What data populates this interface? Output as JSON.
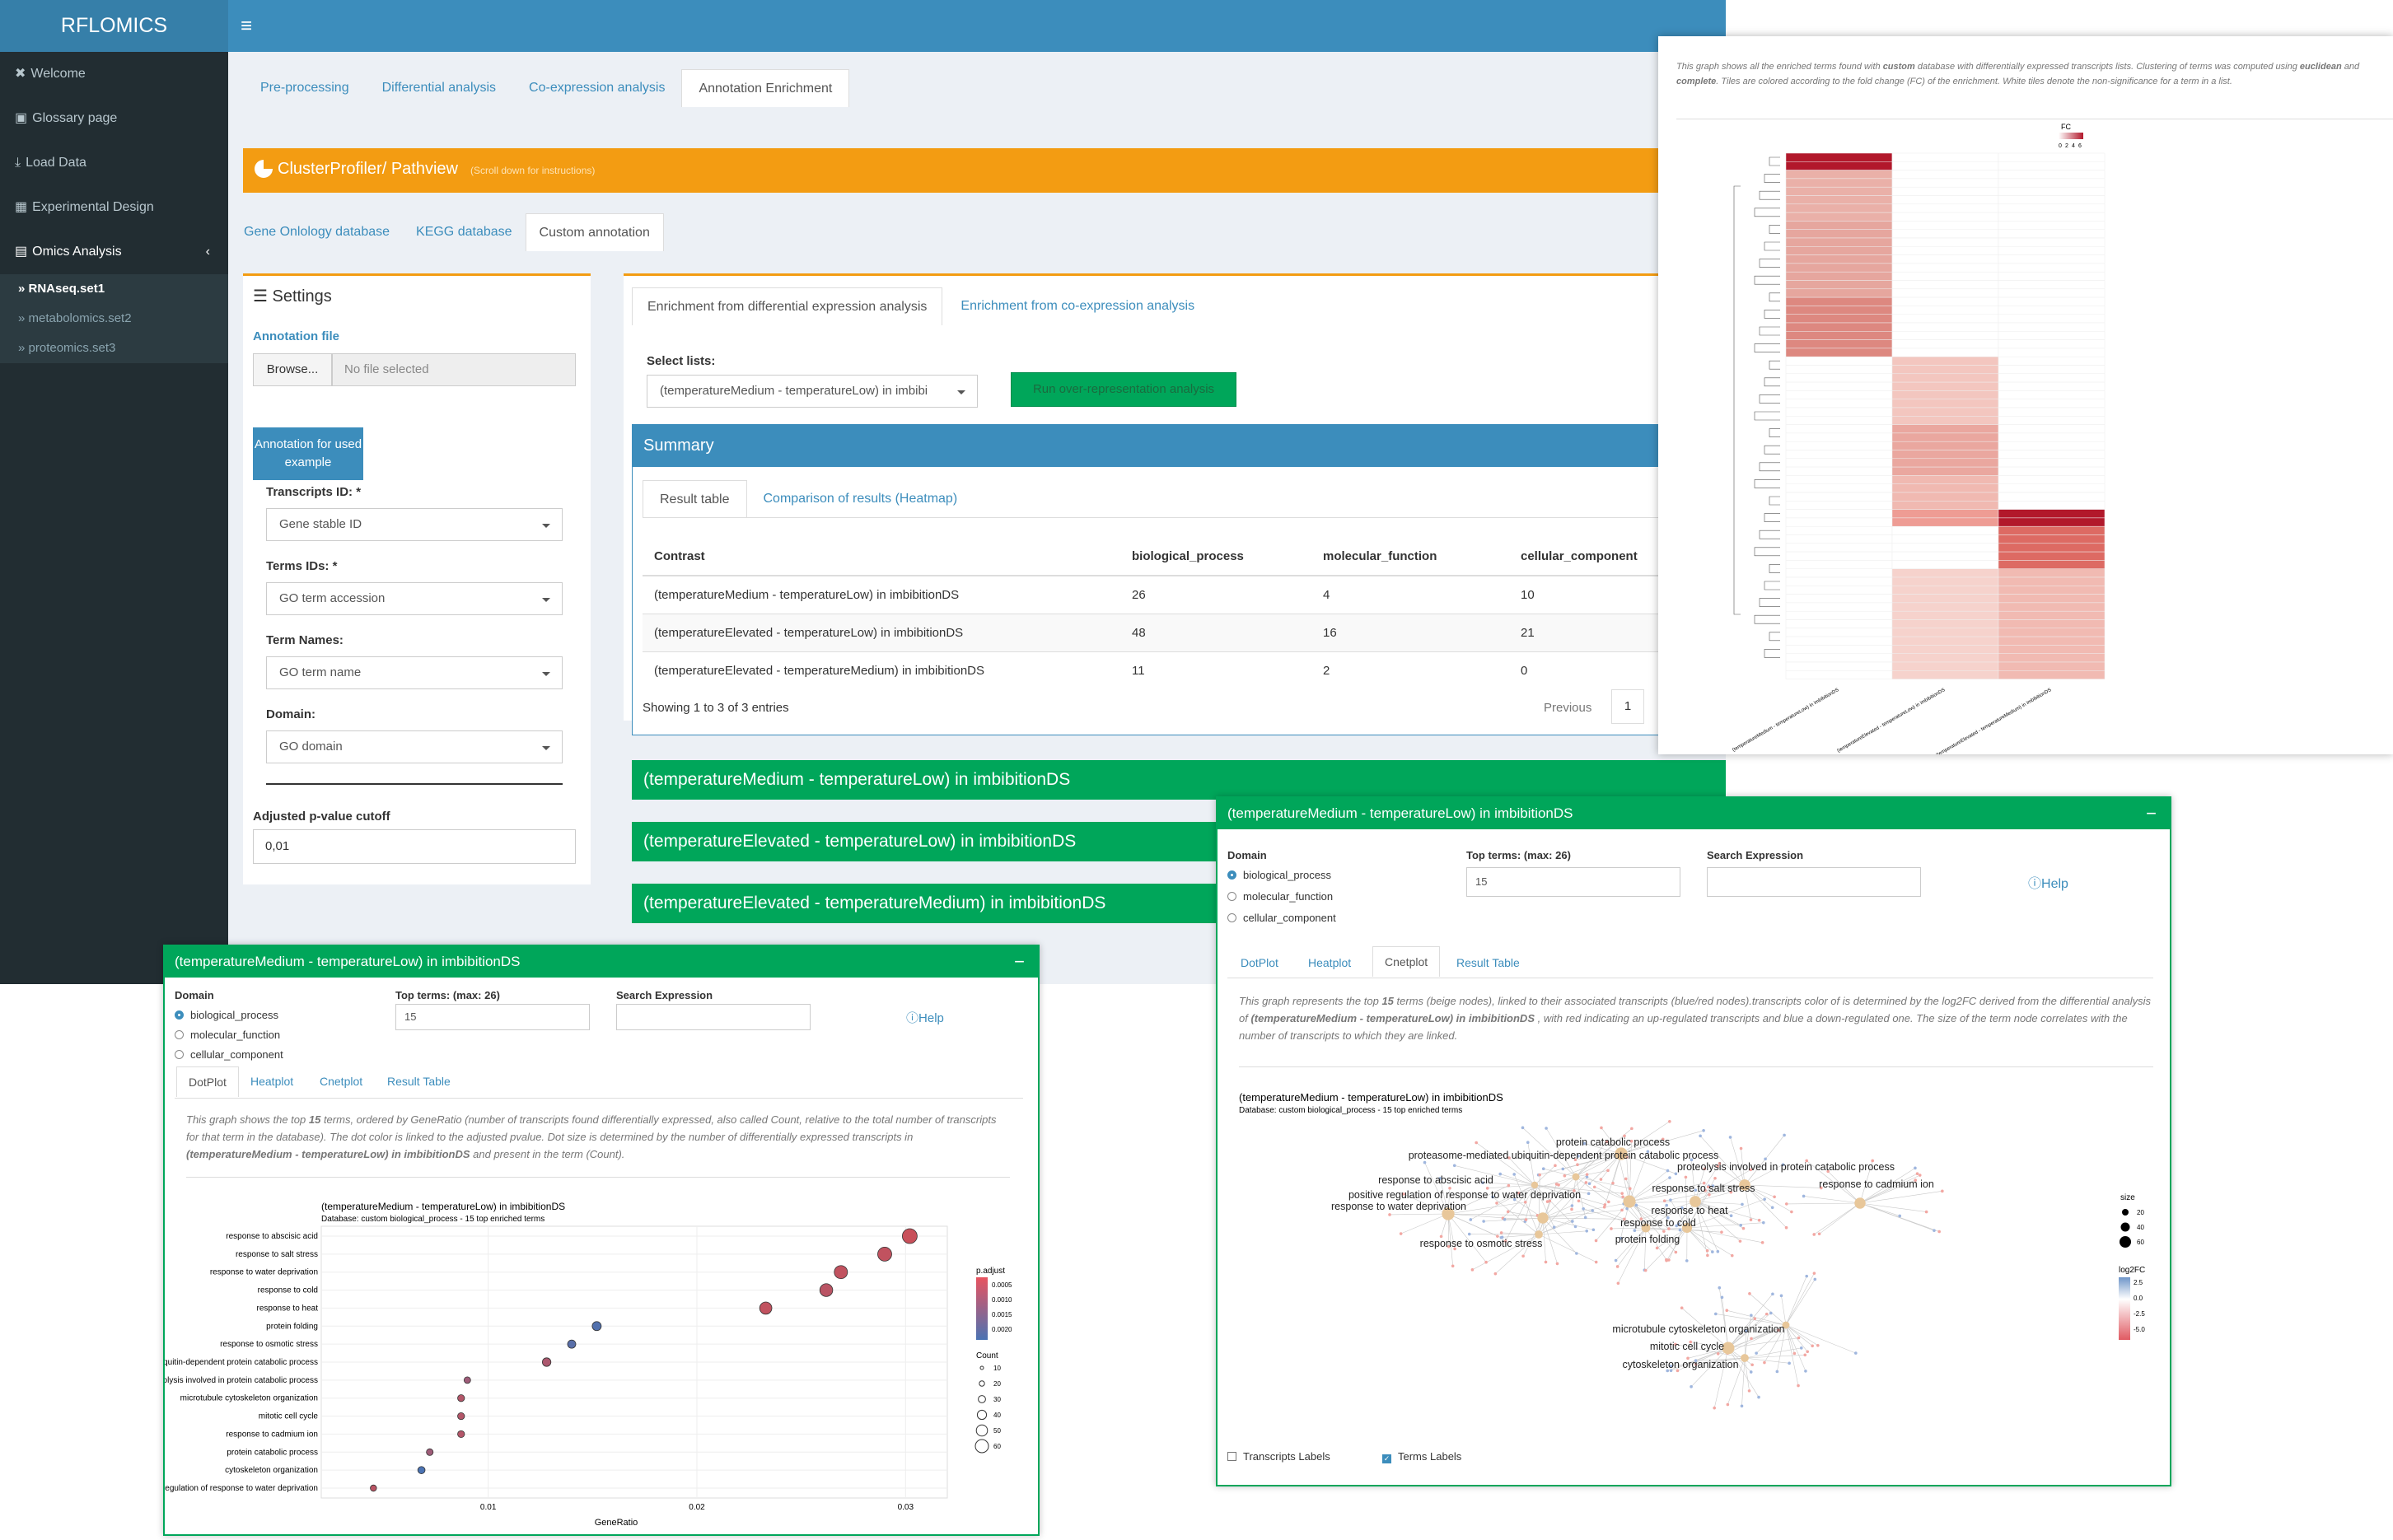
{
  "app": {
    "brand": "RFLOMICS"
  },
  "sidebar": {
    "items": [
      {
        "label": "Welcome",
        "icon": "close-icon"
      },
      {
        "label": "Glossary page",
        "icon": "book-icon"
      },
      {
        "label": "Load Data",
        "icon": "download-icon"
      },
      {
        "label": "Experimental Design",
        "icon": "columns-icon"
      },
      {
        "label": "Omics Analysis",
        "icon": "chart-icon"
      }
    ],
    "datasets": [
      "RNAseq.set1",
      "metabolomics.set2",
      "proteomics.set3"
    ]
  },
  "main_tabs": [
    "Pre-processing",
    "Differential analysis",
    "Co-expression analysis",
    "Annotation Enrichment"
  ],
  "cp_header": {
    "title": "ClusterProfiler/ Pathview",
    "hint": "(Scroll down for instructions)"
  },
  "db_tabs": [
    "Gene Onlology database",
    "KEGG database",
    "Custom annotation"
  ],
  "settings": {
    "title": "Settings",
    "annotation_file_label": "Annotation file",
    "browse": "Browse...",
    "no_file": "No file selected",
    "example_button": "Annotation for used example",
    "transcripts_id_label": "Transcripts ID: *",
    "transcripts_id_value": "Gene stable ID",
    "terms_ids_label": "Terms IDs: *",
    "terms_ids_value": "GO term accession",
    "term_names_label": "Term Names:",
    "term_names_value": "GO term name",
    "domain_label": "Domain:",
    "domain_value": "GO domain",
    "cutoff_label": "Adjusted p-value cutoff",
    "cutoff_value": "0,01"
  },
  "enrich_tabs": [
    "Enrichment from differential expression analysis",
    "Enrichment from co-expression analysis"
  ],
  "select_lists_label": "Select lists:",
  "select_lists_value": "(temperatureMedium - temperatureLow) in imbibi",
  "run_button": "Run over-representation analysis",
  "summary": {
    "title": "Summary",
    "tabs": [
      "Result table",
      "Comparison of results (Heatmap)"
    ],
    "columns": [
      "Contrast",
      "biological_process",
      "molecular_function",
      "cellular_component"
    ],
    "rows": [
      [
        "(temperatureMedium - temperatureLow) in imbibitionDS",
        "26",
        "4",
        "10"
      ],
      [
        "(temperatureElevated - temperatureLow) in imbibitionDS",
        "48",
        "16",
        "21"
      ],
      [
        "(temperatureElevated - temperatureMedium) in imbibitionDS",
        "11",
        "2",
        "0"
      ]
    ],
    "footer": "Showing 1 to 3 of 3 entries",
    "previous": "Previous",
    "page": "1"
  },
  "contrasts": [
    "(temperatureMedium - temperatureLow) in imbibitionDS",
    "(temperatureElevated - temperatureLow) in imbibitionDS",
    "(temperatureElevated - temperatureMedium) in imbibitionDS"
  ],
  "heatmap_panel": {
    "desc_1": "This graph shows all the enriched terms found with ",
    "desc_db": "custom",
    "desc_2": " database with differentially expressed transcripts lists. Clustering of terms was computed using ",
    "desc_method1": "euclidean",
    "desc_and": " and ",
    "desc_method2": "complete",
    "desc_3": ". Tiles are colored according to the fold change (FC) of the enrichment. White tiles denote the non-significance for a term in a list.",
    "legend_title": "FC",
    "legend_ticks": [
      "0",
      "2",
      "4",
      "6"
    ],
    "colors": {
      "high": "#b2182b",
      "mid": "#e8a39a",
      "low": "#f7d9d3",
      "white": "#ffffff"
    }
  },
  "card_common": {
    "domain_label": "Domain",
    "domains": [
      "biological_process",
      "molecular_function",
      "cellular_component"
    ],
    "top_terms_label": "Top terms: (max: 26)",
    "top_terms_value": "15",
    "search_label": "Search Expression",
    "help": "Help",
    "tabs": [
      "DotPlot",
      "Heatplot",
      "Cnetplot",
      "Result Table"
    ],
    "title": "(temperatureMedium - temperatureLow) in imbibitionDS"
  },
  "dotplot": {
    "desc_a": "This graph shows the top ",
    "desc_n": "15",
    "desc_b": " terms, ordered by GeneRatio (number of transcripts found differentially expressed, also called Count, relative to the total number of transcripts for that term in the database). The dot color is linked to the adjusted pvalue. Dot size is determined by the number of differentially expressed transcripts in ",
    "desc_c": "(temperatureMedium - temperatureLow) in imbibitionDS",
    "desc_d": " and present in the term (Count).",
    "plot_title": "(temperatureMedium - temperatureLow) in imbibitionDS",
    "plot_subtitle": "Database: custom biological_process - 15 top enriched terms",
    "xlabel": "GeneRatio",
    "legend_padj_title": "p.adjust",
    "legend_count_title": "Count"
  },
  "chart_data": {
    "type": "scatter",
    "title": "(temperatureMedium - temperatureLow) in imbibitionDS",
    "subtitle": "Database: custom biological_process - 15 top enriched terms",
    "xlabel": "GeneRatio",
    "ylabel": "",
    "xticks": [
      "0.01",
      "0.02",
      "0.03"
    ],
    "xlim": [
      0.002,
      0.032
    ],
    "categories": [
      "response to abscisic acid",
      "response to salt stress",
      "response to water deprivation",
      "response to cold",
      "response to heat",
      "protein folding",
      "response to osmotic stress",
      "proteasome-mediated ubiquitin-dependent protein catabolic process",
      "proteolysis involved in protein catabolic process",
      "microtubule cytoskeleton organization",
      "mitotic cell cycle",
      "response to cadmium ion",
      "protein catabolic process",
      "cytoskeleton organization",
      "positive regulation of response to water deprivation"
    ],
    "x": [
      0.0302,
      0.029,
      0.0269,
      0.0262,
      0.0233,
      0.0152,
      0.014,
      0.0128,
      0.009,
      0.0087,
      0.0087,
      0.0087,
      0.0072,
      0.0068,
      0.0045
    ],
    "p_adjust": [
      0.0004,
      0.0005,
      0.0005,
      0.0006,
      0.0005,
      0.0021,
      0.002,
      0.0008,
      0.001,
      0.0007,
      0.0007,
      0.0007,
      0.001,
      0.0022,
      0.0006
    ],
    "count": [
      60,
      55,
      50,
      48,
      44,
      25,
      20,
      22,
      10,
      12,
      12,
      12,
      11,
      14,
      8
    ],
    "legend_padj": [
      "0.0005",
      "0.0010",
      "0.0015",
      "0.0020"
    ],
    "legend_count": [
      "10",
      "20",
      "30",
      "40",
      "50",
      "60"
    ],
    "grid": true
  },
  "cnet": {
    "desc_a": "This graph represents the top ",
    "desc_n": "15",
    "desc_b": " terms (beige nodes), linked to their associated transcripts (blue/red nodes).transcripts color of is determined by the log2FC derived from the differential analysis of ",
    "desc_c": "(temperatureMedium - temperatureLow) in imbibitionDS",
    "desc_d": " , with red indicating an up-regulated transcripts and blue a down-regulated one. The size of the term node correlates with the number of transcripts to which they are linked.",
    "plot_title": "(temperatureMedium - temperatureLow) in imbibitionDS",
    "plot_subtitle": "Database: custom biological_process - 15 top enriched terms",
    "terms": [
      "protein catabolic process",
      "proteasome-mediated ubiquitin-dependent protein catabolic process",
      "proteolysis involved in protein catabolic process",
      "response to cadmium ion",
      "response to abscisic acid",
      "response to salt stress",
      "positive regulation of response to water deprivation",
      "response to heat",
      "response to water deprivation",
      "response to cold",
      "protein folding",
      "response to osmotic stress",
      "microtubule cytoskeleton organization",
      "mitotic cell cycle",
      "cytoskeleton organization"
    ],
    "size_title": "size",
    "size_ticks": [
      "20",
      "40",
      "60"
    ],
    "fc_title": "log2FC",
    "fc_ticks": [
      "2.5",
      "0.0",
      "-2.5",
      "-5.0"
    ],
    "transcripts_labels": "Transcripts Labels",
    "terms_labels": "Terms Labels"
  }
}
